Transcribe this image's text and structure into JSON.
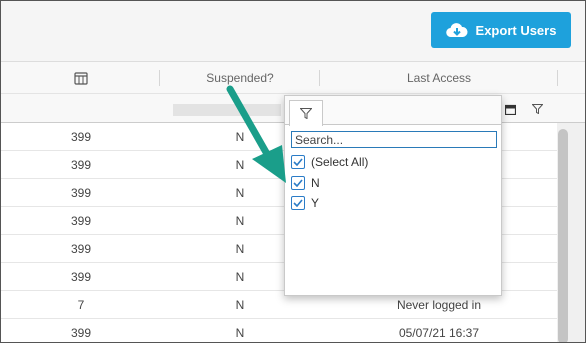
{
  "toolbar": {
    "export_label": "Export Users"
  },
  "grid": {
    "headers": [
      "Suspended?",
      "Last Access"
    ],
    "rows": [
      [
        "399",
        "N",
        ""
      ],
      [
        "399",
        "N",
        ""
      ],
      [
        "399",
        "N",
        ""
      ],
      [
        "399",
        "N",
        ""
      ],
      [
        "399",
        "N",
        ""
      ],
      [
        "399",
        "N",
        ""
      ],
      [
        "7",
        "N",
        "Never logged in"
      ],
      [
        "399",
        "N",
        "05/07/21 16:37"
      ]
    ]
  },
  "filter_popup": {
    "search_placeholder": "Search...",
    "options": [
      {
        "label": "(Select All)",
        "checked": true
      },
      {
        "label": "N",
        "checked": true
      },
      {
        "label": "Y",
        "checked": true
      }
    ]
  },
  "colors": {
    "accent": "#1ea1dc",
    "arrow": "#1a9e8a",
    "checkbox": "#2b7cc7"
  },
  "icons": [
    "cloud-download-icon",
    "columns-icon",
    "calendar-icon",
    "filter-icon",
    "arrow-annotation"
  ]
}
